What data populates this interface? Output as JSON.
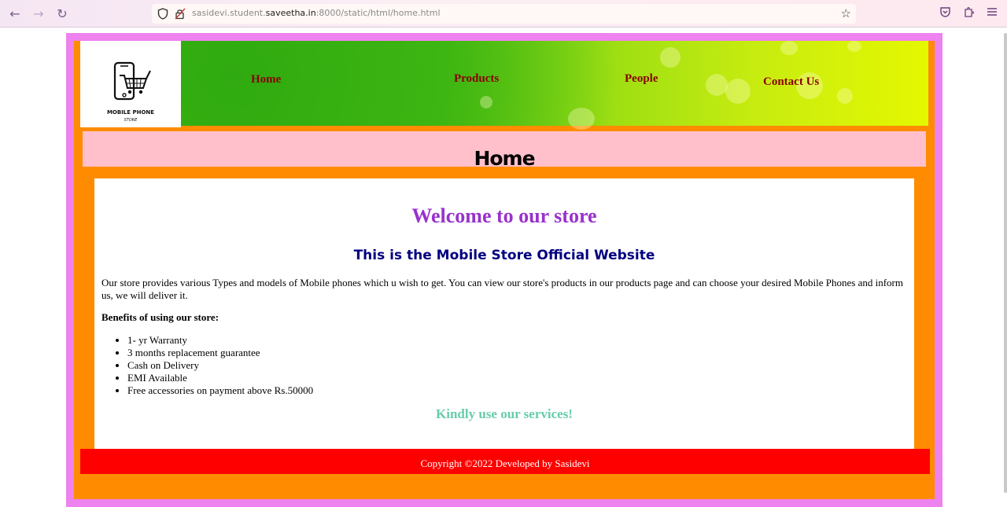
{
  "browser": {
    "url_prefix": "sasidevi.student.",
    "url_domain": "saveetha.in",
    "url_suffix": ":8000/static/html/home.html"
  },
  "logo": {
    "line1": "MOBILE PHONE",
    "line2": "STORE"
  },
  "nav": {
    "home": "Home",
    "products": "Products",
    "people": "People",
    "contact": "Contact Us"
  },
  "page_title": "Home",
  "content": {
    "welcome": "Welcome to our store",
    "subtitle": "This is the Mobile Store Official Website",
    "paragraph": "Our store provides various Types and models of Mobile phones which u wish to get. You can view our store's products in our products page and can choose your desired Mobile Phones and inform us, we will deliver it.",
    "benefits_heading": "Benefits of using our store:",
    "benefits": [
      "1- yr Warranty",
      "3 months replacement guarantee",
      "Cash on Delivery",
      "EMI Available",
      "Free accessories on payment above Rs.50000"
    ],
    "closing": "Kindly use our services!"
  },
  "footer": "Copyright ©2022 Developed by Sasidevi",
  "colors": {
    "outer": "#ee82ee",
    "frame": "#ff8c00",
    "title_bar": "#ffc0cb",
    "footer": "#ff0000",
    "welcome": "#9932cc",
    "nav_text": "#8b0000"
  }
}
